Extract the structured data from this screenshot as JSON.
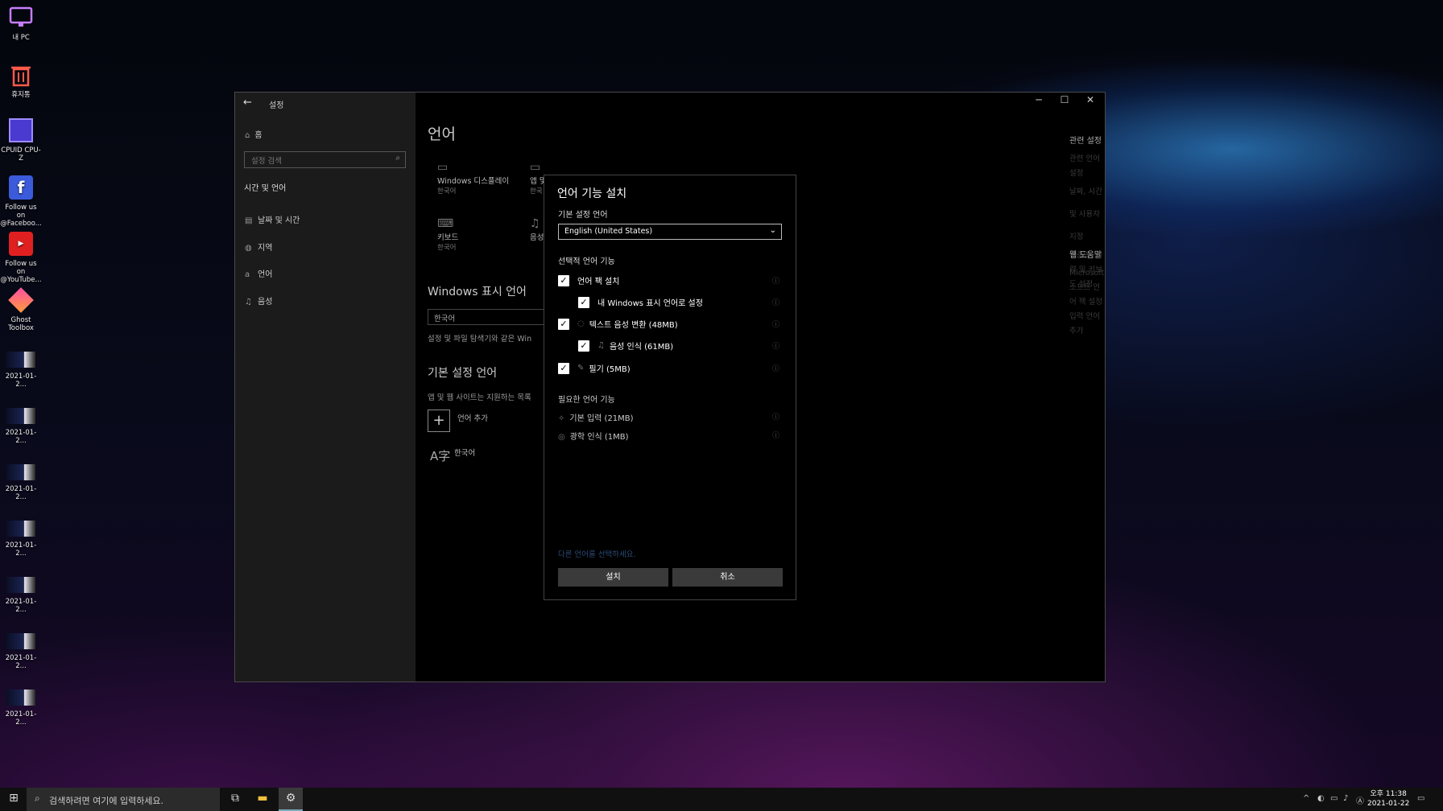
{
  "desktop": {
    "icons": [
      {
        "label": "내 PC",
        "icon": "monitor-icon"
      },
      {
        "label": "휴지통",
        "icon": "recycle-bin-icon"
      },
      {
        "label": "CPUID CPU-Z",
        "icon": "cpu-z-icon"
      },
      {
        "label": "Follow us on @Faceboo...",
        "icon": "facebook-icon"
      },
      {
        "label": "Follow us on @YouTube...",
        "icon": "youtube-icon"
      },
      {
        "label": "Ghost Toolbox",
        "icon": "ghost-toolbox-icon"
      },
      {
        "label": "2021-01-2..."
      },
      {
        "label": "2021-01-2..."
      },
      {
        "label": "2021-01-2..."
      },
      {
        "label": "2021-01-2..."
      },
      {
        "label": "2021-01-2..."
      },
      {
        "label": "2021-01-2..."
      },
      {
        "label": "2021-01-2..."
      }
    ]
  },
  "settings": {
    "title": "설정",
    "sidebar": {
      "home": "홈",
      "search_placeholder": "설정 검색",
      "category": "시간 및 언어",
      "items": [
        {
          "label": "날짜 및 시간",
          "icon": "calendar-clock-icon"
        },
        {
          "label": "지역",
          "icon": "globe-icon"
        },
        {
          "label": "언어",
          "icon": "language-icon"
        },
        {
          "label": "음성",
          "icon": "microphone-icon"
        }
      ]
    },
    "page_title": "언어",
    "tiles": [
      {
        "label": "Windows 디스플레이",
        "sub": "한국어"
      },
      {
        "label": "앱 및",
        "sub": "한국"
      },
      {
        "label": "키보드",
        "sub": "한국어"
      },
      {
        "label": "음성",
        "sub": ""
      }
    ],
    "display_lang_heading": "Windows 표시 언어",
    "display_lang_value": "한국어",
    "display_lang_desc": "설정 및 파일 탐색기와 같은 Win",
    "preferred_heading": "기본 설정 언어",
    "preferred_desc": "앱 및 웹 사이트는 지원하는 목록",
    "add_language": "언어 추가",
    "language_item": "한국어",
    "related": {
      "title": "관련 설정",
      "links": [
        "관련 언어 설정",
        "날짜, 시간 및 사용자 지정",
        "맞춤법, 입력 및 키보드 설정"
      ]
    },
    "help": {
      "title": "웹 도움말",
      "links": [
        "Microsoft 소프트 언어 팩 설정",
        "입력 언어 추가"
      ]
    }
  },
  "dialog": {
    "title": "언어 기능 설치",
    "preferred_label": "기본 설정 언어",
    "selected_language": "English (United States)",
    "optional_heading": "선택적 언어 기능",
    "options": [
      {
        "label": "언어 팩 설치",
        "checked": true
      },
      {
        "label": "내 Windows 표시 언어로 설정",
        "checked": true
      },
      {
        "label": "텍스트 음성 변환 (48MB)",
        "checked": true
      },
      {
        "label": "음성 인식 (61MB)",
        "checked": true
      },
      {
        "label": "필기 (5MB)",
        "checked": true
      }
    ],
    "required_heading": "필요한 언어 기능",
    "required": [
      {
        "label": "기본 입력 (21MB)"
      },
      {
        "label": "광학 인식 (1MB)"
      }
    ],
    "choose_other": "다른 언어를 선택하세요.",
    "install": "설치",
    "cancel": "취소"
  },
  "taskbar": {
    "search_placeholder": "검색하려면 여기에 입력하세요.",
    "time": "오후 11:38",
    "date": "2021-01-22"
  }
}
